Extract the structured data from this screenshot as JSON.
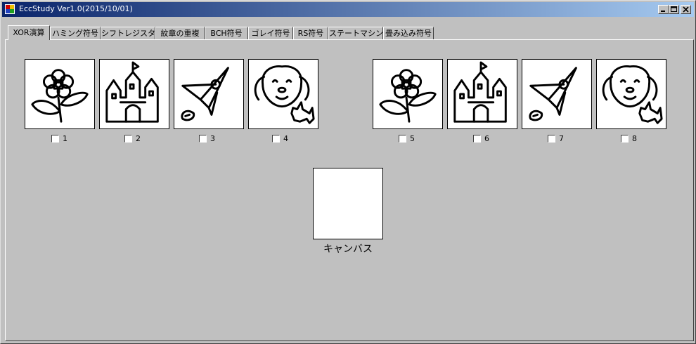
{
  "window": {
    "title": "EccStudy Ver1.0(2015/10/01)"
  },
  "title_buttons": {
    "minimize_icon": "minimize-icon",
    "maximize_icon": "maximize-icon",
    "close_icon": "close-icon"
  },
  "tabs": [
    {
      "label": "XOR演算",
      "active": true
    },
    {
      "label": "ハミング符号",
      "active": false
    },
    {
      "label": "シフトレジスタ",
      "active": false
    },
    {
      "label": "紋章の重複",
      "active": false
    },
    {
      "label": "BCH符号",
      "active": false
    },
    {
      "label": "ゴレイ符号",
      "active": false
    },
    {
      "label": "RS符号",
      "active": false
    },
    {
      "label": "ステートマシン",
      "active": false
    },
    {
      "label": "畳み込み符号",
      "active": false
    }
  ],
  "images": [
    {
      "icon": "flower-icon",
      "label": "1",
      "checked": false
    },
    {
      "icon": "castle-icon",
      "label": "2",
      "checked": false
    },
    {
      "icon": "rocket-icon",
      "label": "3",
      "checked": false
    },
    {
      "icon": "dog-icon",
      "label": "4",
      "checked": false
    },
    {
      "icon": "flower-icon",
      "label": "5",
      "checked": false
    },
    {
      "icon": "castle-icon",
      "label": "6",
      "checked": false
    },
    {
      "icon": "rocket-icon",
      "label": "7",
      "checked": false
    },
    {
      "icon": "dog-icon",
      "label": "8",
      "checked": false
    }
  ],
  "canvas": {
    "label": "キャンバス"
  }
}
